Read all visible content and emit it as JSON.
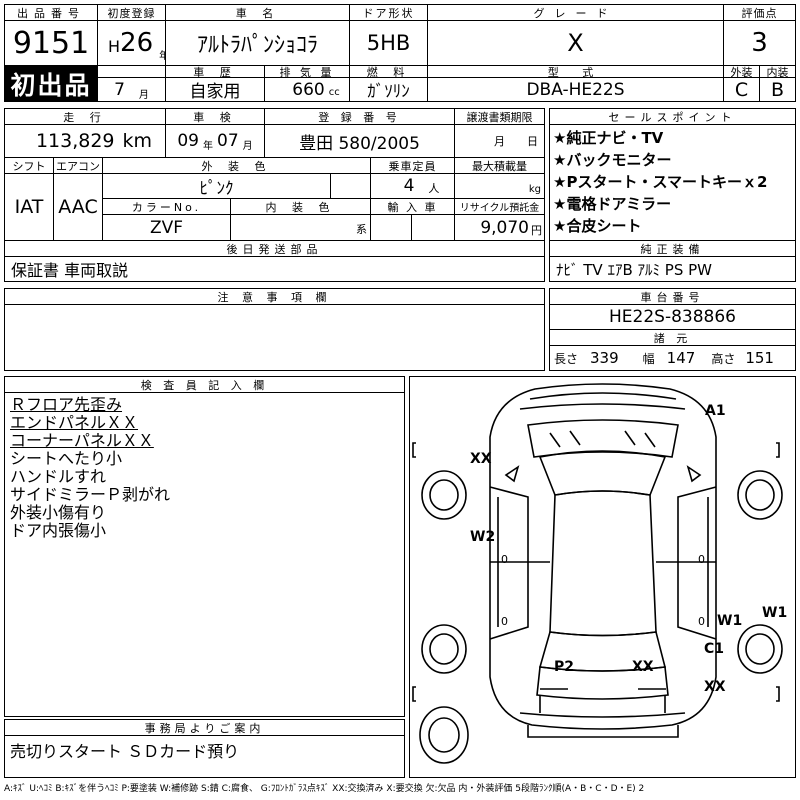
{
  "header": {
    "lot_label": "出品番号",
    "lot_number": "9151",
    "first_reg_label": "初度登録",
    "era": "H",
    "year": "26",
    "year_unit": "年",
    "month": "7",
    "month_unit": "月",
    "name_label": "車 名",
    "car_name": "ｱﾙﾄﾗﾊﾟﾝｼｮｺﾗ",
    "door_label": "ドア形状",
    "door": "5HB",
    "grade_label": "グレード",
    "grade": "X",
    "score_label": "評価点",
    "score": "3",
    "first_listing": "初出品",
    "history_label": "車 歴",
    "history": "自家用",
    "displacement_label": "排 気 量",
    "displacement": "660",
    "displacement_unit": "cc",
    "fuel_label": "燃 料",
    "fuel": "ｶﾞｿﾘﾝ",
    "model_label": "型 式",
    "model": "DBA-HE22S",
    "exterior_grade_label": "外装",
    "exterior_grade": "C",
    "interior_grade_label": "内装",
    "interior_grade": "B"
  },
  "row2": {
    "mileage_label": "走 行",
    "mileage": "113,829",
    "mileage_unit": "km",
    "inspection_label": "車 検",
    "inspection_year": "09",
    "inspection_year_unit": "年",
    "inspection_month": "07",
    "inspection_month_unit": "月",
    "plate_label": "登 録 番 号",
    "plate": "豊田 580/2005",
    "transfer_label": "譲渡書類期限",
    "transfer_month_unit": "月",
    "transfer_day_unit": "日"
  },
  "row3": {
    "shift_label": "シフト",
    "shift": "IAT",
    "ac_label": "エアコン",
    "ac": "AAC",
    "color_label": "外 装 色",
    "color": "ﾋﾟﾝｸ",
    "capacity_label": "乗車定員",
    "capacity": "4",
    "capacity_unit": "人",
    "load_label": "最大積載量",
    "load_unit": "kg",
    "color_no_label": "カラーNo.",
    "color_no": "ZVF",
    "interior_color_label": "内 装 色",
    "interior_color_unit": "系",
    "import_label": "輸 入 車",
    "recycle_label": "リサイクル預託金",
    "recycle": "9,070",
    "recycle_unit": "円"
  },
  "selling_points": {
    "label": "セールスポイント",
    "items": [
      "★純正ナビ・TV",
      "★バックモニター",
      "★Pスタート・スマートキーｘ2",
      "★電格ドアミラー",
      "★合皮シート"
    ]
  },
  "delivery": {
    "label": "後日発送部品",
    "text": "保証書 車両取説"
  },
  "equipment": {
    "label": "純正装備",
    "text": "ﾅﾋﾞ TV ｴｱB ｱﾙﾐ PS PW"
  },
  "caution": {
    "label": "注 意 事 項 欄"
  },
  "chassis": {
    "label": "車台番号",
    "number": "HE22S-838866"
  },
  "dimensions": {
    "label": "諸 元",
    "length_label": "長さ",
    "length": "339",
    "width_label": "幅",
    "width": "147",
    "height_label": "高さ",
    "height": "151"
  },
  "inspector": {
    "label": "検 査 員 記 入 欄",
    "notes": [
      {
        "text": "Ｒフロア先歪み",
        "underline": true
      },
      {
        "text": "エンドパネルＸＸ",
        "underline": true
      },
      {
        "text": "コーナーパネルＸＸ",
        "underline": true
      },
      {
        "text": "シートへたり小",
        "underline": false
      },
      {
        "text": "ハンドルすれ",
        "underline": false
      },
      {
        "text": "サイドミラーＰ剥がれ",
        "underline": false
      },
      {
        "text": "外装小傷有り",
        "underline": false
      },
      {
        "text": "ドア内張傷小",
        "underline": false
      }
    ]
  },
  "diagram_marks": {
    "A1": "A1",
    "XX_top": "XX",
    "W2": "W2",
    "W1_a": "W1",
    "W1_b": "W1",
    "C1": "C1",
    "P2": "P2",
    "XX_mid": "XX",
    "XX_bottom": "XX",
    "zero": "0"
  },
  "office": {
    "label": "事務局よりご案内",
    "text": "売切りスタート ＳＤカード預り"
  },
  "legend": "A:ｷｽﾞ U:ﾍｺﾐ B:ｷｽﾞを伴うﾍｺﾐ P:要塗装 W:補修跡 S:錆 C:腐食、 G:ﾌﾛﾝﾄｶﾞﾗｽ点ｷｽﾞ XX:交換済み X:要交換 欠:欠品 内・外装評価 5段階ﾗﾝｸ順(A・B・C・D・E) 2"
}
